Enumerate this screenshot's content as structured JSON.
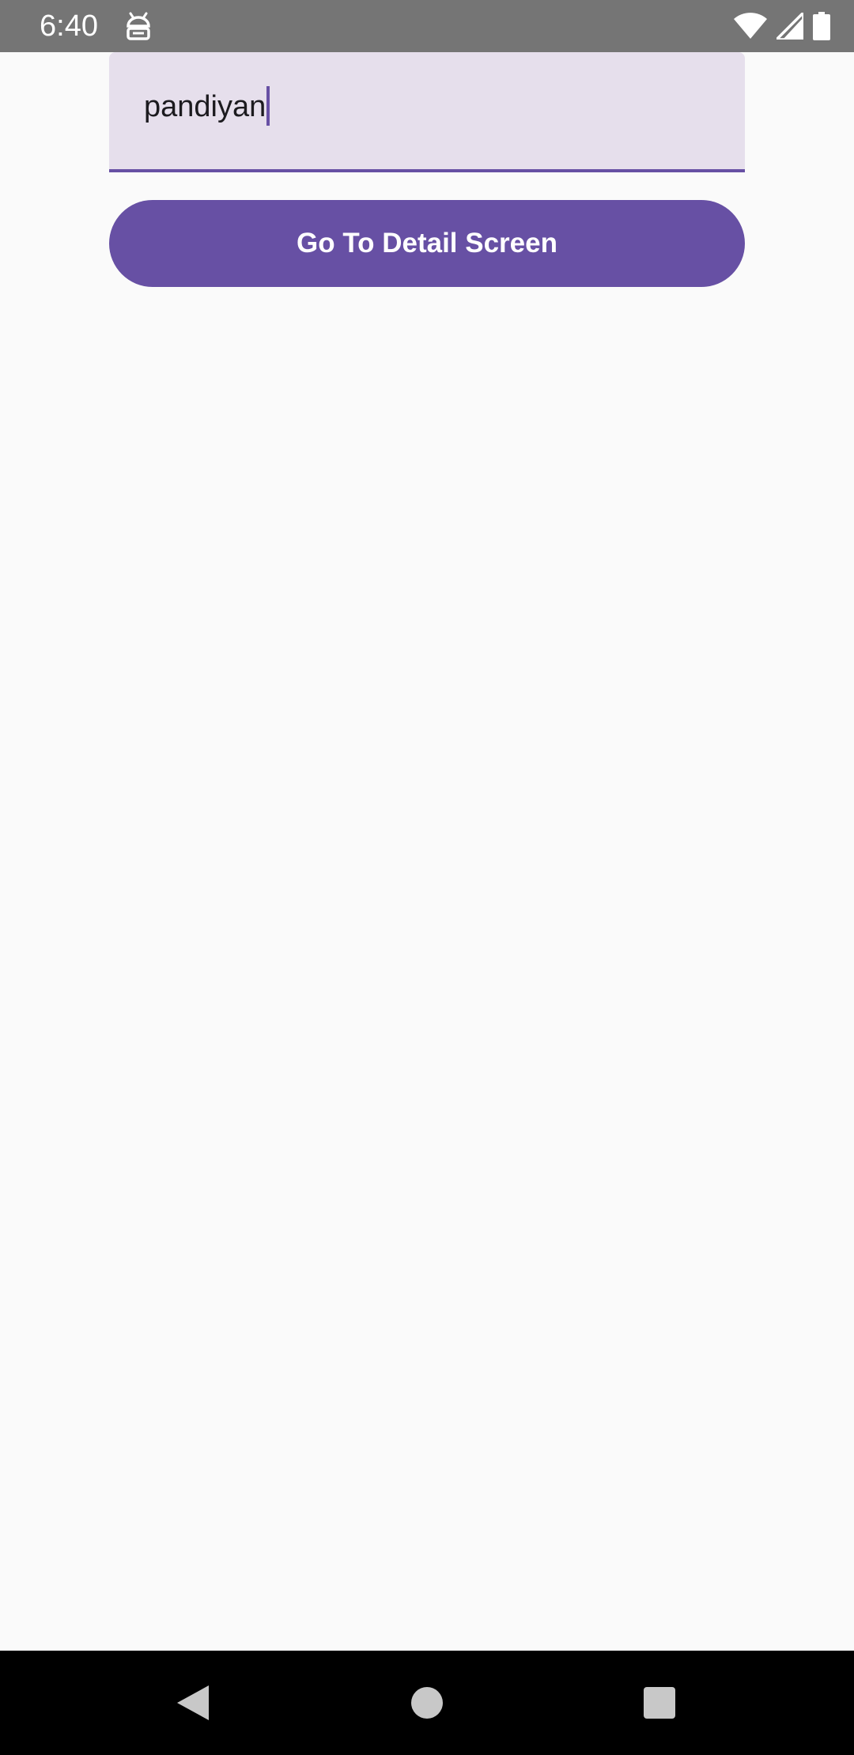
{
  "status_bar": {
    "time": "6:40",
    "app_icon": "android-debug-icon",
    "wifi_icon": "wifi-icon",
    "signal_icon": "cellular-signal-icon",
    "battery_icon": "battery-icon",
    "background_color": "#757575"
  },
  "form": {
    "text_field_value": "pandiyan",
    "text_field_background": "#e6dfec",
    "accent_color": "#6750a4"
  },
  "actions": {
    "detail_button_label": "Go To Detail Screen",
    "button_color": "#6750a4"
  },
  "nav_bar": {
    "back_icon": "back-triangle-icon",
    "home_icon": "home-circle-icon",
    "recents_icon": "recents-square-icon"
  }
}
